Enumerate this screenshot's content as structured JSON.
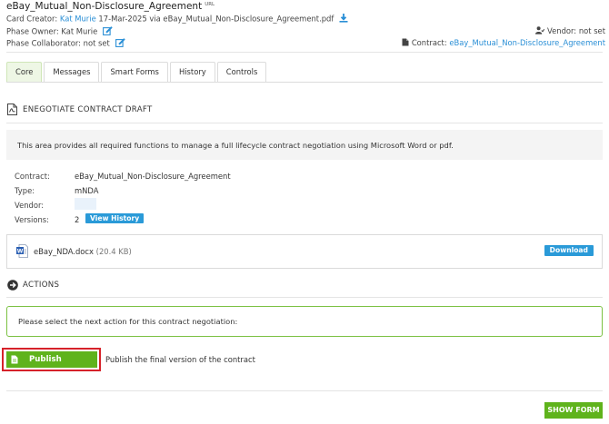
{
  "header": {
    "title": "eBay_Mutual_Non-Disclosure_Agreement",
    "url_tag": "URL",
    "card_creator_label": "Card Creator:",
    "card_creator_name": "Kat Murie",
    "card_creator_rest": "17-Mar-2025 via eBay_Mutual_Non-Disclosure_Agreement.pdf",
    "phase_owner_label": "Phase Owner:",
    "phase_owner_value": "Kat Murie",
    "phase_collaborator_label": "Phase Collaborator:",
    "phase_collaborator_value": "not set",
    "vendor_label": "Vendor:",
    "vendor_value": "not set",
    "contract_label": "Contract:",
    "contract_value": "eBay_Mutual_Non-Disclosure_Agreement"
  },
  "tabs": [
    "Core",
    "Messages",
    "Smart Forms",
    "History",
    "Controls"
  ],
  "section": {
    "title": "ENEGOTIATE CONTRACT DRAFT",
    "info": "This area provides all required functions to manage a full lifecycle contract negotiation using Microsoft Word or pdf."
  },
  "fields": {
    "contract_label": "Contract:",
    "contract_value": "eBay_Mutual_Non-Disclosure_Agreement",
    "type_label": "Type:",
    "type_value": "mNDA",
    "vendor_label": "Vendor:",
    "versions_label": "Versions:",
    "versions_value": "2",
    "view_history": "View History"
  },
  "file": {
    "name": "eBay_NDA.docx",
    "size": "(20.4 KB)",
    "download": "Download"
  },
  "actions": {
    "title": "ACTIONS",
    "prompt": "Please select the next action for this contract negotiation:",
    "publish_label": "Publish",
    "publish_desc": "Publish the final version of the contract",
    "show_form": "SHOW FORM"
  },
  "colors": {
    "link": "#2a8fd6",
    "green": "#5fb31c",
    "blue_button": "#2a9ad8",
    "highlight_red": "#d6222a"
  }
}
